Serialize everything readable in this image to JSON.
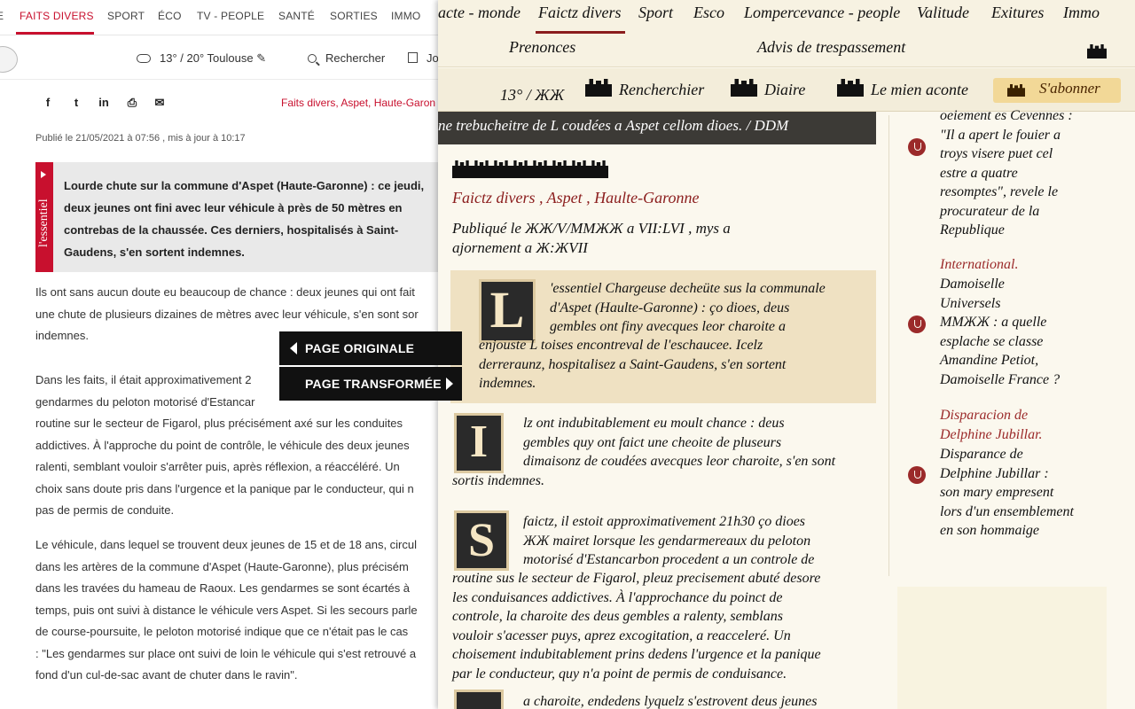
{
  "left": {
    "nav": [
      "FAITS DIVERS",
      "SPORT",
      "ÉCO",
      "TV - PEOPLE",
      "SANTÉ",
      "SORTIES",
      "IMMO"
    ],
    "nav_partial": "E",
    "weather": "13° / 20°  Toulouse",
    "search": "Rechercher",
    "journal": "Jo",
    "share_icons": [
      "f",
      "t",
      "in",
      "⎙",
      "✉"
    ],
    "tags": "Faits divers, Aspet, Haute-Garon",
    "pubdate": "Publié le 21/05/2021 à 07:56 , mis à jour à 10:17",
    "essential_tab": "l'essentiel",
    "essential_text": "Lourde chute sur la commune d'Aspet (Haute-Garonne) : ce jeudi, deux jeunes ont fini avec leur véhicule à près de 50 mètres en contrebas de la chaussée. Ces derniers, hospitalisés à Saint-Gaudens, s'en sortent indemnes.",
    "para1": [
      "Ils ont sans aucun doute eu beaucoup de chance : deux jeunes qui ont fait",
      "une chute de plusieurs dizaines de mètres avec leur véhicule, s'en sont sor",
      "indemnes."
    ],
    "para2": [
      "Dans les faits, il était approximativement 2",
      "gendarmes du peloton motorisé d'Estancar",
      "routine sur le secteur de Figarol, plus précisément axé sur les conduites",
      "addictives. À l'approche du point de contrôle, le véhicule des deux jeunes",
      "ralenti, semblant vouloir s'arrêter puis, après réflexion, a réaccéléré. Un",
      "choix sans doute pris dans l'urgence et la panique par le conducteur, qui n",
      "pas de permis de conduite."
    ],
    "para3": [
      "Le véhicule, dans lequel se trouvent deux jeunes de 15 et de 18 ans, circul",
      "dans les artères de la commune d'Aspet (Haute-Garonne), plus précisém",
      "dans les travées du hameau de Raoux. Les gendarmes se sont écartés à",
      "temps, puis ont suivi à distance le véhicule vers Aspet. Si les secours parle",
      "de course-poursuite, le peloton motorisé indique que ce n'était pas le cas",
      ": \"Les gendarmes sur place ont suivi de loin le véhicule qui s'est retrouvé a",
      "fond d'un cul-de-sac avant de chuter dans le ravin\"."
    ]
  },
  "toggle": {
    "original": "PAGE ORIGINALE",
    "transformed": "PAGE TRANSFORMÉE"
  },
  "right": {
    "nav": [
      "acte - monde",
      "Faictz divers",
      "Sport",
      "Esco",
      "Lompercevance - people",
      "Valitude",
      "Exitures",
      "Immo"
    ],
    "sub_nav": [
      "Prenonces",
      "Advis de trespassement"
    ],
    "temp": "13° / ЖЖ",
    "util_links": [
      "Rencherchier",
      "Diaire",
      "Le mien aconte"
    ],
    "subscribe": "S'abonner",
    "banner": "ne trebucheitre de L coudées a Aspet cellom dioes. / DDM",
    "tags": "Faictz divers , Aspet , Haulte-Garonne",
    "pub": [
      "Publiqué le ЖЖ/V/ММЖЖ a VII:LVI , mys a",
      "ajornement a Ж:ЖVII"
    ],
    "ess_cap": "L",
    "ess_lines": [
      "'essentiel Chargeuse decheüte sus la communale",
      "d'Aspet (Haulte-Garonne) : ço dioes, deus",
      "gembles ont finy avecques leor charoite a",
      "enjouste L toises encontreval de l'eschaucee. Icelz",
      "derreraunz, hospitalisez a Saint-Gaudens, s'en sortent",
      "indemnes."
    ],
    "p1_cap": "I",
    "p1_lines": [
      "lz ont indubitablement eu moult chance : deus",
      "gembles quy ont faict une cheoite de pluseurs",
      "dimaisonz de coudées avecques leor charoite, s'en sont",
      "sortis indemnes."
    ],
    "p2_cap": "S",
    "p2_lines": [
      "faictz, il estoit approximativement 21h30 ço dioes",
      "ЖЖ mairet lorsque les gendarmereaux du peloton",
      "motorisé d'Estancarbon procedent a un controle de",
      "routine sus le secteur de Figarol, pleuz precisement abuté desore",
      "les conduisances addictives. À l'approchance du poinct de",
      "controle, la charoite des deus gembles a ralenty, semblans",
      "vouloir s'acesser puys, aprez excogitation, a reacceleré. Un",
      "choisement indubitablement prins dedens l'urgence et la panique",
      "par le conducteur, quy n'a point de permis de conduisance."
    ],
    "p3_partial": "a charoite, endedens lyquelz s'estrovent deus jeunes",
    "sidebar": {
      "item1_lines": [
        "oeiement es Cevennes :",
        "\"Il a apert le fouier a",
        "troys visere puet cel",
        "estre a quatre",
        "resomptes\", revele le",
        "procurateur de la",
        "Republique"
      ],
      "item2_cat": "International.",
      "item2_lines": [
        "Damoiselle",
        "Universels",
        "ММЖЖ : a quelle",
        "esplache se classe",
        "Amandine Petiot,",
        "Damoiselle France ?"
      ],
      "item3_cat": [
        "Disparacion de",
        "Delphine Jubillar."
      ],
      "item3_lines": [
        "Disparance de",
        "Delphine Jubillar :",
        "son mary empresent",
        "lors d'un ensemblement",
        "en son hommaige"
      ]
    }
  }
}
